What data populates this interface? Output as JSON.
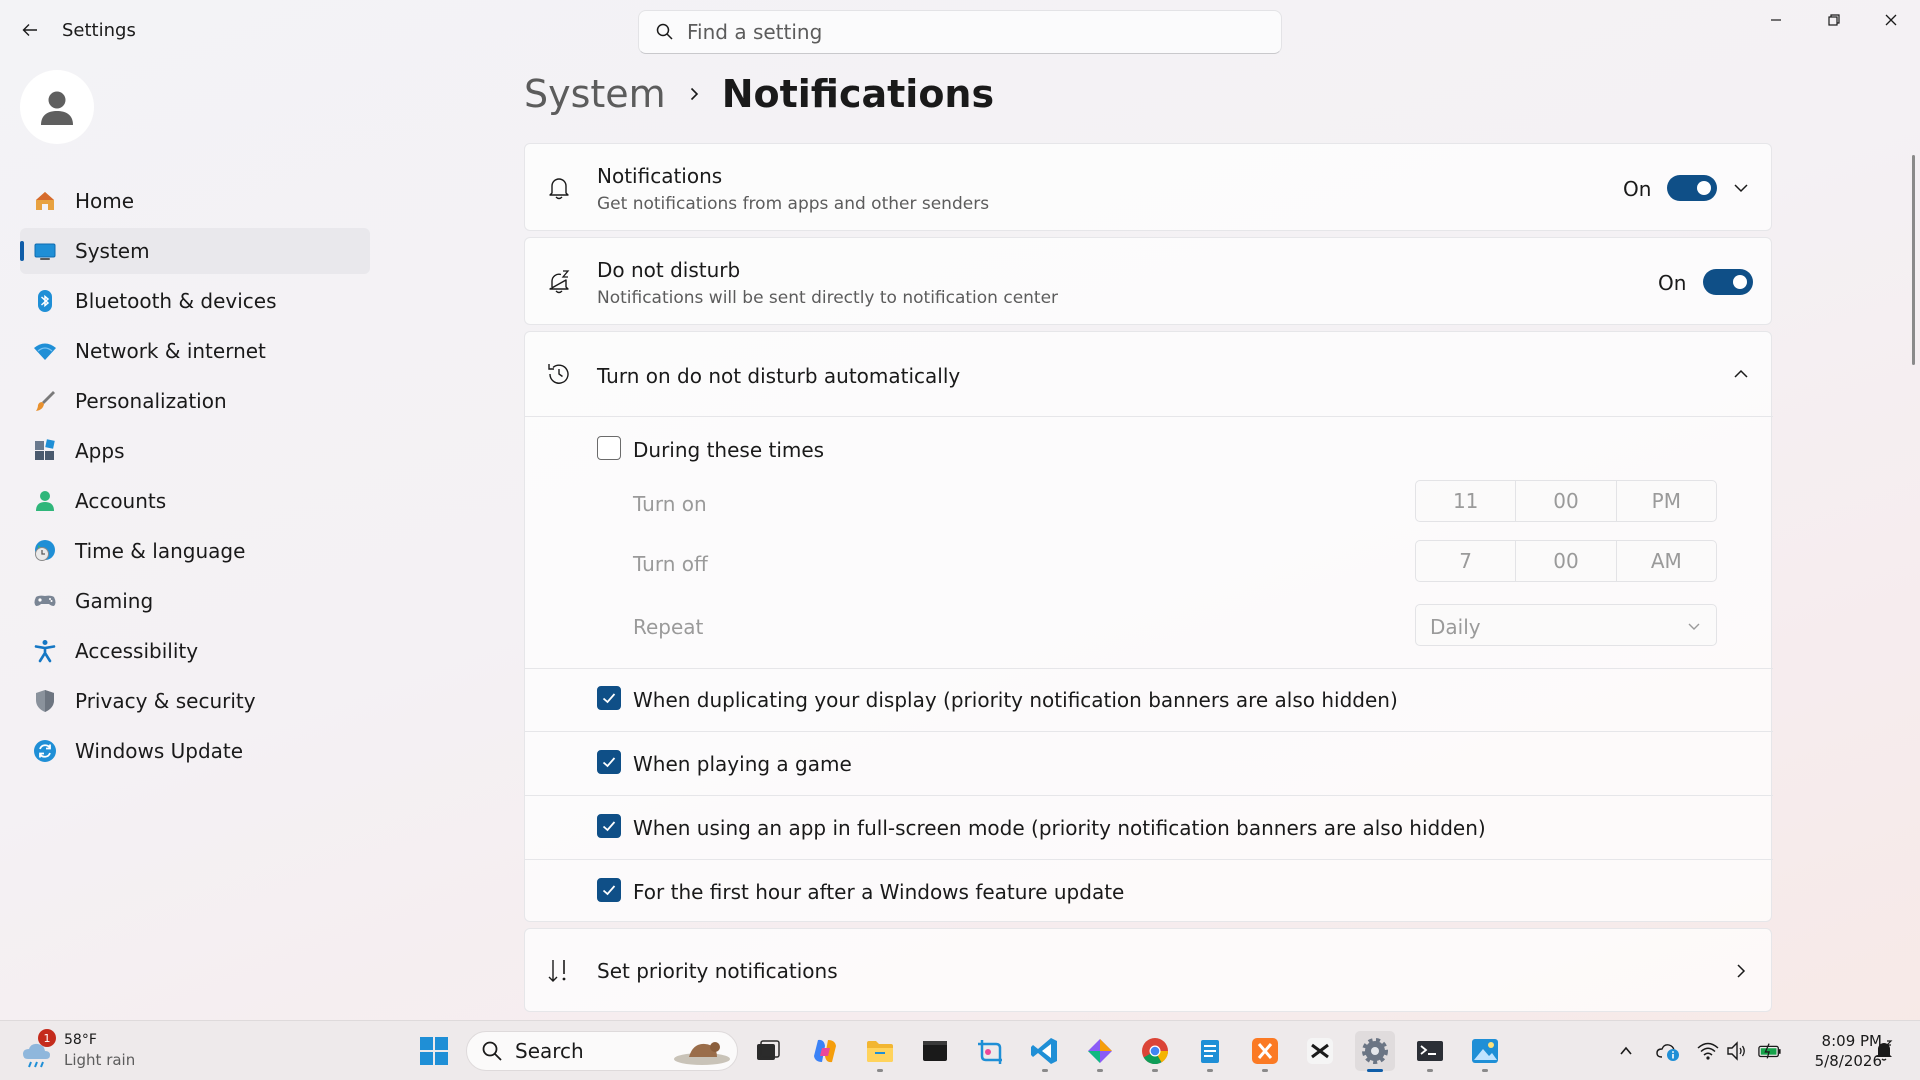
{
  "window": {
    "app_title": "Settings",
    "search_placeholder": "Find a setting"
  },
  "sidebar": {
    "items": [
      {
        "label": "Home",
        "icon": "home-icon"
      },
      {
        "label": "System",
        "icon": "system-icon",
        "active": true
      },
      {
        "label": "Bluetooth & devices",
        "icon": "bluetooth-icon"
      },
      {
        "label": "Network & internet",
        "icon": "wifi-icon"
      },
      {
        "label": "Personalization",
        "icon": "brush-icon"
      },
      {
        "label": "Apps",
        "icon": "apps-icon"
      },
      {
        "label": "Accounts",
        "icon": "accounts-icon"
      },
      {
        "label": "Time & language",
        "icon": "globe-clock-icon"
      },
      {
        "label": "Gaming",
        "icon": "gamepad-icon"
      },
      {
        "label": "Accessibility",
        "icon": "accessibility-icon"
      },
      {
        "label": "Privacy & security",
        "icon": "shield-icon"
      },
      {
        "label": "Windows Update",
        "icon": "update-icon"
      }
    ]
  },
  "breadcrumb": {
    "parent": "System",
    "current": "Notifications"
  },
  "notifications": {
    "title": "Notifications",
    "subtitle": "Get notifications from apps and other senders",
    "state": "On"
  },
  "dnd": {
    "title": "Do not disturb",
    "subtitle": "Notifications will be sent directly to notification center",
    "state": "On"
  },
  "auto_dnd": {
    "title": "Turn on do not disturb automatically",
    "during_times": {
      "label": "During these times",
      "checked": false
    },
    "turn_on": {
      "label": "Turn on",
      "hour": "11",
      "minute": "00",
      "period": "PM"
    },
    "turn_off": {
      "label": "Turn off",
      "hour": "7",
      "minute": "00",
      "period": "AM"
    },
    "repeat": {
      "label": "Repeat",
      "value": "Daily"
    },
    "options": [
      {
        "label": "When duplicating your display (priority notification banners are also hidden)",
        "checked": true
      },
      {
        "label": "When playing a game",
        "checked": true
      },
      {
        "label": "When using an app in full-screen mode (priority notification banners are also hidden)",
        "checked": true
      },
      {
        "label": "For the first hour after a Windows feature update",
        "checked": true
      }
    ]
  },
  "priority": {
    "title": "Set priority notifications"
  },
  "taskbar": {
    "weather": {
      "temp": "58°F",
      "condition": "Light rain",
      "badge": "1"
    },
    "search_label": "Search",
    "clock": {
      "time": "8:09 PM",
      "date": "5/8/2026"
    }
  },
  "colors": {
    "accent": "#0f4f87",
    "accent_light": "#0f5da8"
  }
}
